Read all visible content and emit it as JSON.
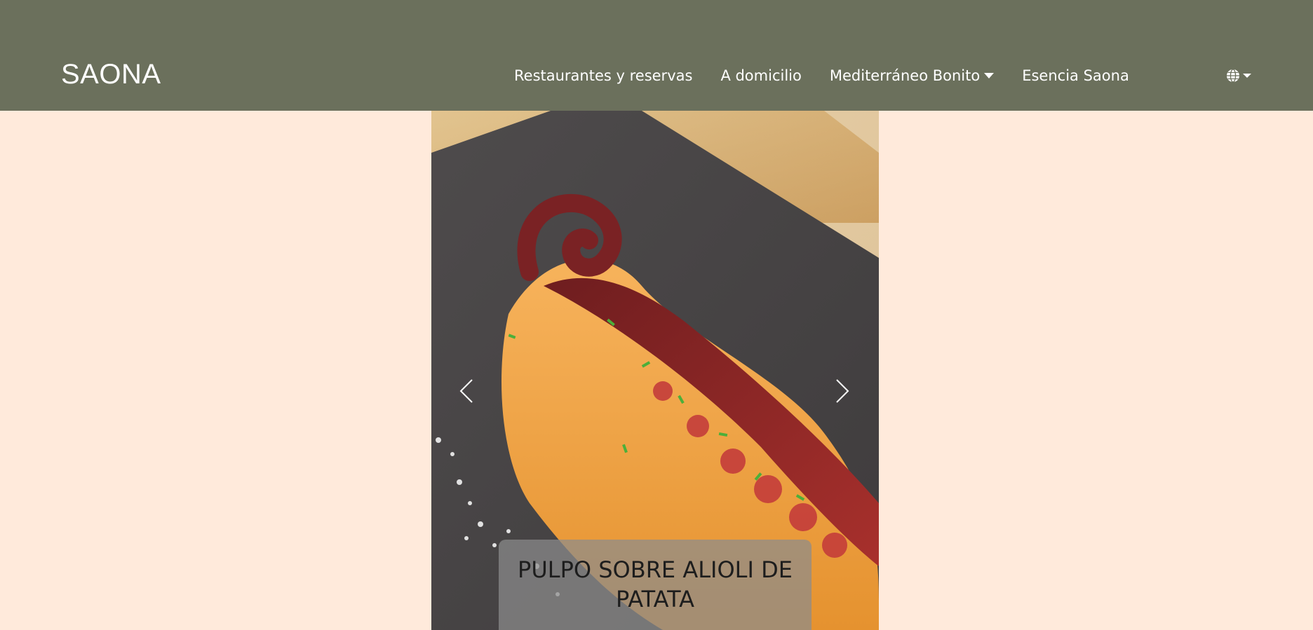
{
  "header": {
    "brand": "SAONA",
    "nav": [
      {
        "label": "Restaurantes y reservas",
        "has_dropdown": false
      },
      {
        "label": "A domicilio",
        "has_dropdown": false
      },
      {
        "label": "Mediterráneo Bonito",
        "has_dropdown": true
      },
      {
        "label": "Esencia Saona",
        "has_dropdown": false
      }
    ],
    "language_icon": "globe-icon"
  },
  "carousel": {
    "caption": "PULPO SOBRE ALIOLI DE PATATA",
    "prev_icon": "chevron-left-icon",
    "next_icon": "chevron-right-icon"
  },
  "colors": {
    "navbar": "#6b705c",
    "page_background": "#ffeadb",
    "caption_background": "#8c8c8c"
  }
}
